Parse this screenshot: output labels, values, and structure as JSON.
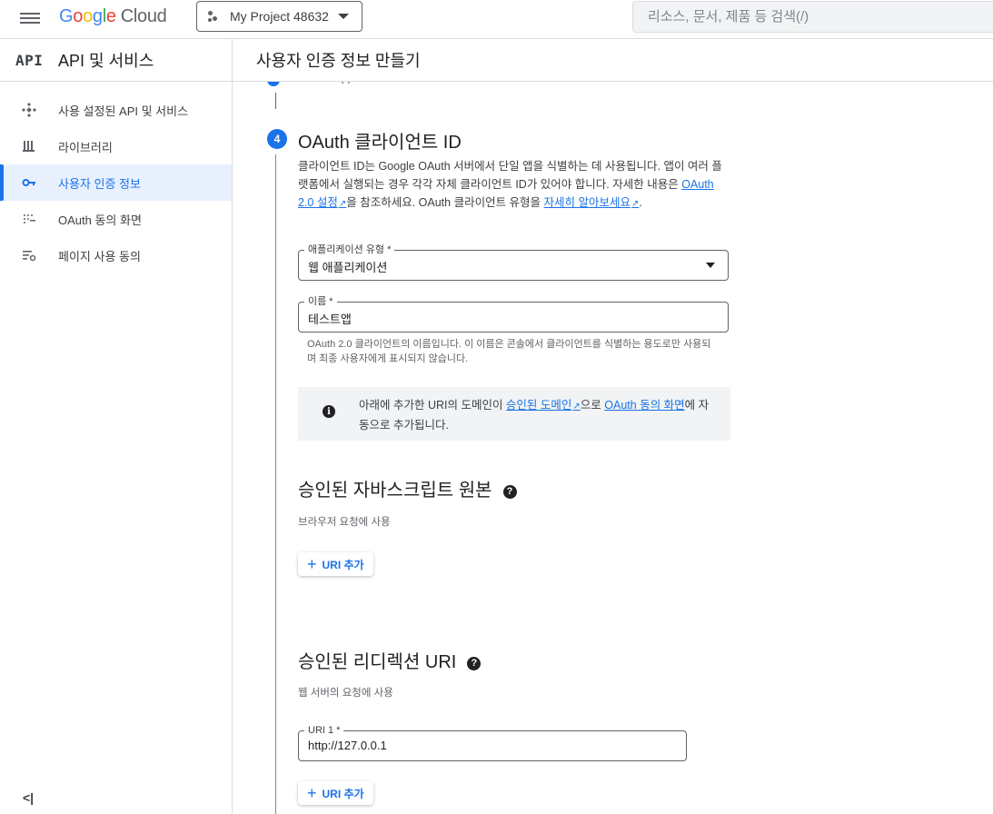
{
  "topbar": {
    "logo_google": "Google",
    "logo_cloud": "Cloud",
    "project_name": "My Project 48632",
    "search_placeholder": "리소스, 문서, 제품 등 검색(/)"
  },
  "sidebar": {
    "api_logo": "API",
    "title": "API 및 서비스",
    "items": [
      {
        "label": "사용 설정된 API 및 서비스",
        "icon": "api-hub-icon"
      },
      {
        "label": "라이브러리",
        "icon": "library-icon"
      },
      {
        "label": "사용자 인증 정보",
        "icon": "key-icon",
        "active": true
      },
      {
        "label": "OAuth 동의 화면",
        "icon": "consent-dots-icon"
      },
      {
        "label": "페이지 사용 동의",
        "icon": "settings-list-icon"
      }
    ],
    "collapse_label": "<|"
  },
  "main": {
    "page_title": "사용자 인증 정보 만들기",
    "prev_step_text": "(          )",
    "step": {
      "number": "4",
      "title": "OAuth 클라이언트 ID",
      "desc_part1": "클라이언트 ID는 Google OAuth 서버에서 단일 앱을 식별하는 데 사용됩니다. 앱이 여러 플랫폼에서 실행되는 경우 각각 자체 클라이언트 ID가 있어야 합니다. 자세한 내용은 ",
      "desc_link1": "OAuth 2.0 설정",
      "desc_part2": "을 참조하세요. OAuth 클라이언트 유형을 ",
      "desc_link2": "자세히 알아보세요",
      "desc_part3": "."
    },
    "app_type": {
      "label": "애플리케이션 유형 *",
      "value": "웹 애플리케이션"
    },
    "name_field": {
      "label": "이름 *",
      "value": "테스트앱",
      "hint": "OAuth 2.0 클라이언트의 이름입니다. 이 이름은 콘솔에서 클라이언트를 식별하는 용도로만 사용되며 최종 사용자에게 표시되지 않습니다."
    },
    "info": {
      "icon": "info-icon",
      "part1": "아래에 추가한 URI의 도메인이 ",
      "link1": "승인된 도메인",
      "part2": "으로 ",
      "link2": "OAuth 동의 화면",
      "part3": "에 자동으로 추가됩니다."
    },
    "js_origins": {
      "title": "승인된 자바스크립트 원본",
      "subtitle": "브라우저 요청에 사용",
      "add_button": "URI 추가"
    },
    "redirect_uris": {
      "title": "승인된 리디렉션 URI",
      "subtitle": "웹 서버의 요청에 사용",
      "uri_label": "URI 1 *",
      "uri_value": "http://127.0.0.1",
      "add_button": "URI 추가"
    }
  },
  "colors": {
    "accent": "#1a73e8",
    "active_bg": "#e8f0fe",
    "info_bg": "#f1f3f4"
  }
}
